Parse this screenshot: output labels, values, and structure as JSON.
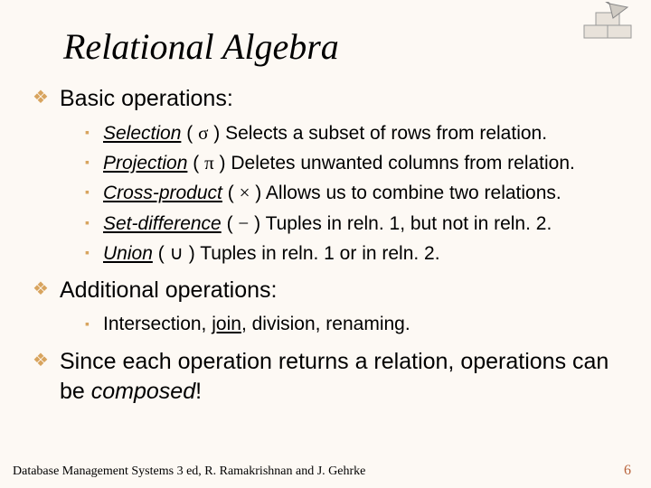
{
  "title": "Relational Algebra",
  "sections": [
    {
      "heading": "Basic operations:",
      "items": [
        {
          "name": "Selection",
          "symbol": "σ",
          "desc": "Selects a subset of rows from relation."
        },
        {
          "name": "Projection",
          "symbol": "π",
          "desc": "Deletes unwanted columns from relation."
        },
        {
          "name": "Cross-product",
          "symbol": "×",
          "desc": "Allows us to combine two relations."
        },
        {
          "name": "Set-difference",
          "symbol": "−",
          "desc": "Tuples in reln. 1, but not in reln. 2."
        },
        {
          "name": "Union",
          "symbol": "∪",
          "desc": "Tuples in reln. 1 or in reln. 2."
        }
      ]
    },
    {
      "heading": "Additional operations:",
      "items_text": {
        "pre": "Intersection, ",
        "join": "join",
        "post": ", division, renaming."
      }
    },
    {
      "closing": {
        "pre": "Since each operation returns a relation, operations can be ",
        "em": "composed",
        "post": "!"
      }
    }
  ],
  "paren": {
    "open": "(  ",
    "close": " )  "
  },
  "footer": "Database Management Systems 3 ed,  R. Ramakrishnan and J. Gehrke",
  "page": "6"
}
